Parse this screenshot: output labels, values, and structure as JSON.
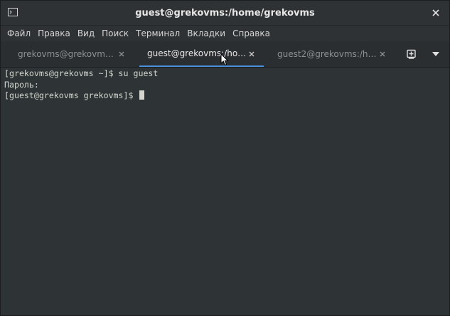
{
  "window": {
    "title": "guest@grekovms:/home/grekovms"
  },
  "menubar": {
    "items": [
      "Файл",
      "Правка",
      "Вид",
      "Поиск",
      "Терминал",
      "Вкладки",
      "Справка"
    ]
  },
  "tabs": [
    {
      "label": "grekovms@grekovm…",
      "active": false
    },
    {
      "label": "guest@grekovms:/ho…",
      "active": true
    },
    {
      "label": "guest2@grekovms:/h…",
      "active": false
    }
  ],
  "terminal": {
    "lines": [
      "[grekovms@grekovms ~]$ su guest",
      "Пароль:",
      "[guest@grekovms grekovms]$ "
    ]
  },
  "icons": {
    "window_icon": "terminal-icon",
    "close": "close-icon",
    "tab_close": "close-icon",
    "new_tab": "new-tab-icon",
    "menu": "chevron-down-icon",
    "pointer": "mouse-pointer-icon"
  },
  "colors": {
    "terminal_bg": "#2e3436",
    "terminal_fg": "#d3d7cf",
    "active_tab_indicator": "#4a90d9"
  }
}
